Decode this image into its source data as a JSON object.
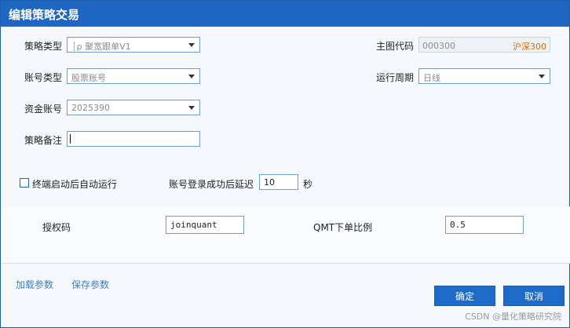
{
  "window": {
    "title": "编辑策略交易"
  },
  "strategy_type": {
    "label": "策略类型",
    "value": "┆ρ 聚宽跟单V1"
  },
  "account_type": {
    "label": "账号类型",
    "value": "股票账号"
  },
  "fund_account": {
    "label": "资金账号",
    "value": "2025390"
  },
  "remark": {
    "label": "策略备注",
    "value": ""
  },
  "chart_code": {
    "label": "主图代码",
    "code": "000300",
    "market": "沪深300"
  },
  "run_period": {
    "label": "运行周期",
    "value": "日线"
  },
  "auto_run": {
    "label": "终端启动后自动运行",
    "checked": false
  },
  "login_delay": {
    "label": "账号登录成功后延迟",
    "value": "10",
    "unit": "秒"
  },
  "auth_code": {
    "label": "授权码",
    "value": "joinquant"
  },
  "qmt_ratio": {
    "label": "QMT下单比例",
    "value": "0.5"
  },
  "footer": {
    "load_params": "加载参数",
    "save_params": "保存参数",
    "ok": "确定",
    "cancel": "取消"
  },
  "watermark": "CSDN @量化策略研究院"
}
